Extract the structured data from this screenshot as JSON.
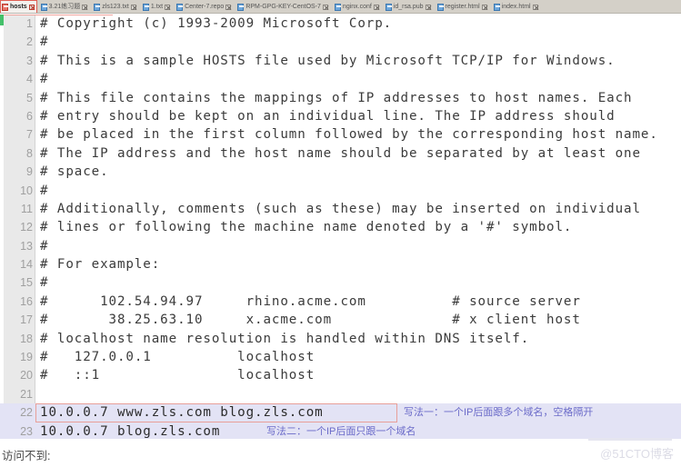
{
  "window": {
    "tabbar_bg": "#d4d0c8",
    "active_accent": "#e06055"
  },
  "tabs": [
    {
      "label": "hosts",
      "icon": "file-icon",
      "active": true
    },
    {
      "label": "3.21练习题",
      "icon": "file-icon",
      "active": false
    },
    {
      "label": "zls123.txt",
      "icon": "file-icon",
      "active": false
    },
    {
      "label": "1.txt",
      "icon": "file-icon",
      "active": false
    },
    {
      "label": "Center-7.repo",
      "icon": "file-icon",
      "active": false
    },
    {
      "label": "RPM-GPG-KEY-CentOS-7",
      "icon": "file-icon",
      "active": false
    },
    {
      "label": "nginx.conf",
      "icon": "file-icon",
      "active": false
    },
    {
      "label": "id_rsa.pub",
      "icon": "file-icon",
      "active": false
    },
    {
      "label": "register.html",
      "icon": "file-icon",
      "active": false
    },
    {
      "label": "index.html",
      "icon": "file-icon",
      "active": false
    }
  ],
  "editor": {
    "gutter_bg": "#e9e9e9",
    "highlight_bg": "#e3e3f5",
    "box_border": "#e89f99",
    "lines": [
      {
        "n": 1,
        "text": "# Copyright (c) 1993-2009 Microsoft Corp."
      },
      {
        "n": 2,
        "text": "#"
      },
      {
        "n": 3,
        "text": "# This is a sample HOSTS file used by Microsoft TCP/IP for Windows."
      },
      {
        "n": 4,
        "text": "#"
      },
      {
        "n": 5,
        "text": "# This file contains the mappings of IP addresses to host names. Each"
      },
      {
        "n": 6,
        "text": "# entry should be kept on an individual line. The IP address should"
      },
      {
        "n": 7,
        "text": "# be placed in the first column followed by the corresponding host name."
      },
      {
        "n": 8,
        "text": "# The IP address and the host name should be separated by at least one"
      },
      {
        "n": 9,
        "text": "# space."
      },
      {
        "n": 10,
        "text": "#"
      },
      {
        "n": 11,
        "text": "# Additionally, comments (such as these) may be inserted on individual"
      },
      {
        "n": 12,
        "text": "# lines or following the machine name denoted by a '#' symbol."
      },
      {
        "n": 13,
        "text": "#"
      },
      {
        "n": 14,
        "text": "# For example:"
      },
      {
        "n": 15,
        "text": "#"
      },
      {
        "n": 16,
        "text": "#      102.54.94.97     rhino.acme.com          # source server"
      },
      {
        "n": 17,
        "text": "#       38.25.63.10     x.acme.com              # x client host"
      },
      {
        "n": 18,
        "text": "# localhost name resolution is handled within DNS itself."
      },
      {
        "n": 19,
        "text": "#   127.0.0.1          localhost"
      },
      {
        "n": 20,
        "text": "#   ::1                localhost"
      },
      {
        "n": 21,
        "text": ""
      },
      {
        "n": 22,
        "text": "10.0.0.7 www.zls.com blog.zls.com"
      },
      {
        "n": 23,
        "text": "10.0.0.7 blog.zls.com"
      }
    ],
    "annotations": [
      {
        "line": 22,
        "text": "写法一：一个IP后面跟多个域名，空格隔开"
      },
      {
        "line": 23,
        "text": "写法二：一个IP后面只跟一个域名"
      }
    ]
  },
  "footer": {
    "text": "访问不到:",
    "watermark": "@51CTO博客"
  }
}
